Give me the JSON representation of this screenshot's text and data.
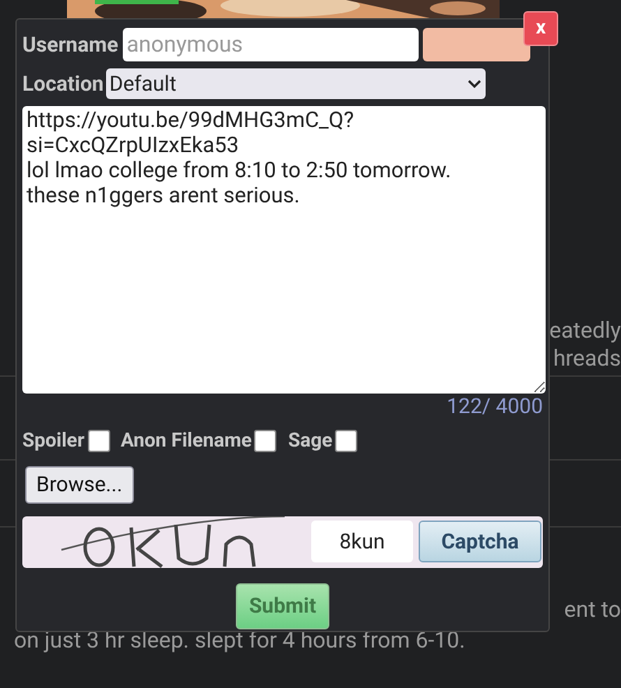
{
  "background": {
    "right_top": [
      "eatedly",
      "hreads"
    ],
    "right_low": "ent to",
    "line": "on just 3 hr sleep. slept for 4 hours from 6-10."
  },
  "form": {
    "close": "x",
    "username": {
      "label": "Username",
      "placeholder": "anonymous"
    },
    "location": {
      "label": "Location",
      "value": "Default"
    },
    "message": {
      "value": "https://youtu.be/99dMHG3mC_Q?si=CxcQZrpUIzxEka53\nlol lmao college from 8:10 to 2:50 tomorrow.\nthese n1ggers arent serious."
    },
    "counter": "122/ 4000",
    "options": [
      {
        "label": "Spoiler",
        "checked": false
      },
      {
        "label": "Anon Filename",
        "checked": false
      },
      {
        "label": "Sage",
        "checked": false
      }
    ],
    "browse": "Browse...",
    "captcha": {
      "value": "8kun",
      "button": "Captcha"
    },
    "submit": "Submit"
  }
}
